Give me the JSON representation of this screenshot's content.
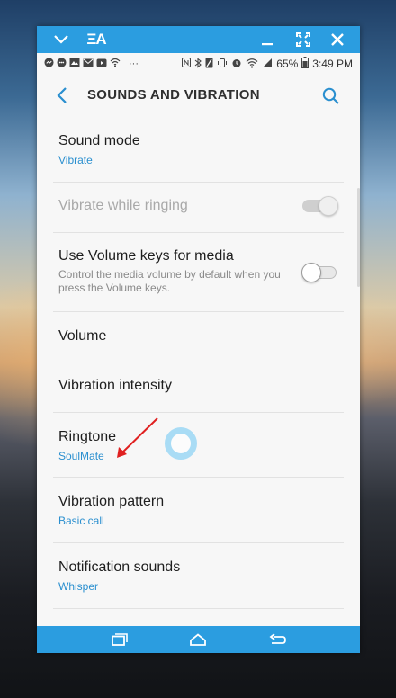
{
  "window": {
    "titlebar": {
      "text_icon": "ΞA",
      "icons": [
        "chevron-down-icon",
        "minimize-icon",
        "maximize-icon",
        "close-icon"
      ]
    },
    "statusbar": {
      "battery": "65%",
      "time": "3:49 PM",
      "dots": "···"
    }
  },
  "appbar": {
    "title": "SOUNDS AND VIBRATION"
  },
  "settings": [
    {
      "title": "Sound mode",
      "value": "Vibrate"
    },
    {
      "title": "Vibrate while ringing",
      "toggle": "on",
      "enabled": false
    },
    {
      "title": "Use Volume keys for media",
      "description": "Control the media volume by default when you press the Volume keys.",
      "toggle": "off"
    },
    {
      "title": "Volume"
    },
    {
      "title": "Vibration intensity"
    },
    {
      "title": "Ringtone",
      "value": "SoulMate"
    },
    {
      "title": "Vibration pattern",
      "value": "Basic call"
    },
    {
      "title": "Notification sounds",
      "value": "Whisper"
    }
  ],
  "colors": {
    "accent": "#2b9de0",
    "value_text": "#2a8fcf",
    "annotation_arrow": "#e02020",
    "touch_indicator": "#a9dcf5"
  },
  "navbar": {
    "icons": [
      "recent-apps-icon",
      "home-icon",
      "back-icon"
    ]
  }
}
